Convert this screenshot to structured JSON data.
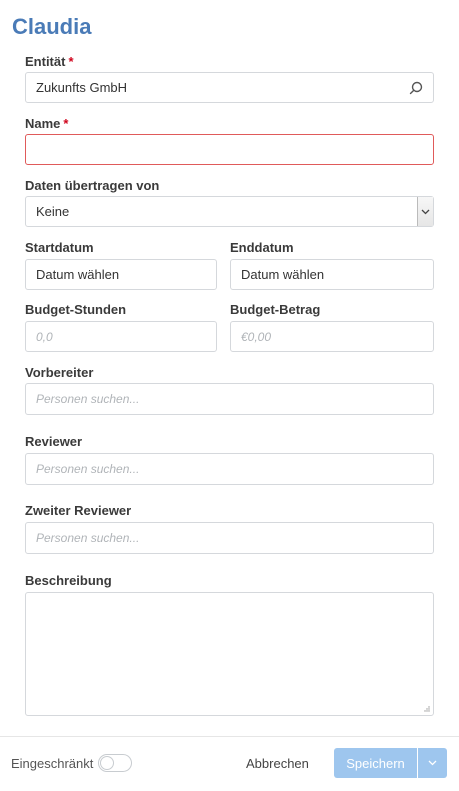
{
  "dialog": {
    "title": "Claudia"
  },
  "form": {
    "entity": {
      "label": "Entität",
      "required_mark": "*",
      "value": "Zukunfts GmbH"
    },
    "name": {
      "label": "Name",
      "required_mark": "*",
      "value": ""
    },
    "copy_data_from": {
      "label": "Daten übertragen von",
      "selected": "Keine"
    },
    "start_date": {
      "label": "Startdatum",
      "value": "Datum wählen"
    },
    "end_date": {
      "label": "Enddatum",
      "value": "Datum wählen"
    },
    "budget_hours": {
      "label": "Budget-Stunden",
      "placeholder": "0,0"
    },
    "budget_amount": {
      "label": "Budget-Betrag",
      "placeholder": "€0,00"
    },
    "preparer": {
      "label": "Vorbereiter",
      "placeholder": "Personen suchen..."
    },
    "reviewer": {
      "label": "Reviewer",
      "placeholder": "Personen suchen..."
    },
    "second_reviewer": {
      "label": "Zweiter Reviewer",
      "placeholder": "Personen suchen..."
    },
    "description": {
      "label": "Beschreibung",
      "value": ""
    }
  },
  "footer": {
    "restricted_label": "Eingeschränkt",
    "restricted_on": false,
    "cancel_label": "Abbrechen",
    "save_label": "Speichern"
  },
  "colors": {
    "title": "#4a7bb7",
    "required": "#d0021b",
    "error_border": "#e05a5a",
    "primary_button": "#9ec6ee"
  }
}
